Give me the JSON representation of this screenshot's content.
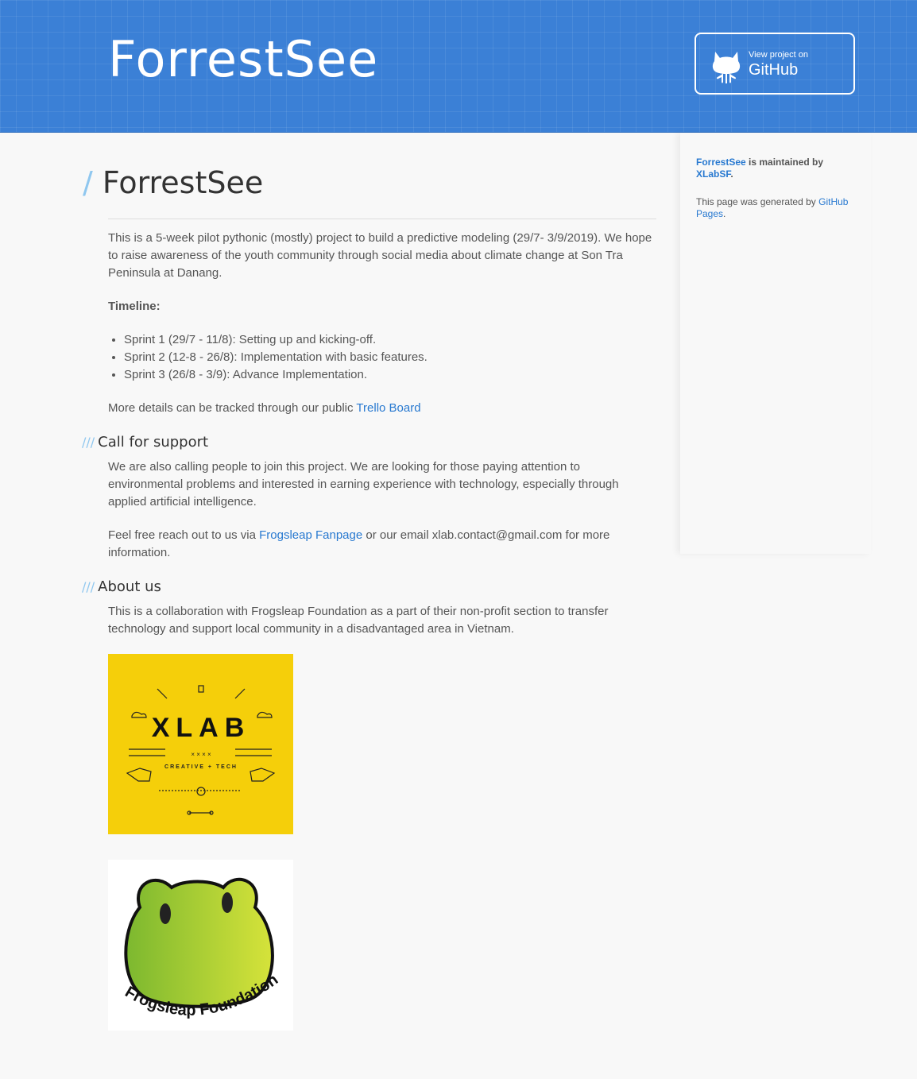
{
  "header": {
    "title": "ForrestSee",
    "github_button": {
      "small": "View project on",
      "big": "GitHub"
    }
  },
  "main": {
    "heading": "ForrestSee",
    "heading_slash": "/",
    "intro": "This is a 5-week pilot pythonic (mostly) project to build a predictive modeling (29/7- 3/9/2019). We hope to raise awareness of the youth community through social media about climate change at Son Tra Peninsula at Danang.",
    "timeline_label": "Timeline:",
    "timeline": [
      "Sprint 1 (29/7 - 11/8): Setting up and kicking-off.",
      "Sprint 2 (12-8 - 26/8): Implementation with basic features.",
      "Sprint 3 (26/8 - 3/9): Advance Implementation."
    ],
    "details_text": "More details can be tracked through our public ",
    "details_link": "Trello Board",
    "section_slashes": "///",
    "support_heading": "Call for support",
    "support_text": "We are also calling people to join this project. We are looking for those paying attention to environmental problems and interested in earning experience with technology, especially through applied artificial intelligence.",
    "reach_pre": "Feel free reach out to us via ",
    "reach_link": "Frogsleap Fanpage",
    "reach_post": " or our email xlab.contact@gmail.com for more information.",
    "about_heading": "About us",
    "about_text": "This is a collaboration with Frogsleap Foundation as a part of their non-profit section to transfer technology and support local community in a disadvantaged area in Vietnam.",
    "xlab_logo": {
      "name": "XLAB",
      "tagline": "CREATIVE + TECH",
      "marks": "× × × ×"
    },
    "frog_logo": {
      "name": "Frogsleap Foundation"
    }
  },
  "sidebar": {
    "maintained_link": "ForrestSee",
    "maintained_text": " is maintained by ",
    "maintainer_link": "XLabSF",
    "maintainer_post": ".",
    "generated_text": "This page was generated by ",
    "generated_link": "GitHub Pages",
    "generated_post": "."
  },
  "colors": {
    "header_blue": "#3b80d6",
    "link_blue": "#2879d0",
    "accent_slash": "#8fc7ef",
    "xlab_yellow": "#f5cf0a"
  }
}
